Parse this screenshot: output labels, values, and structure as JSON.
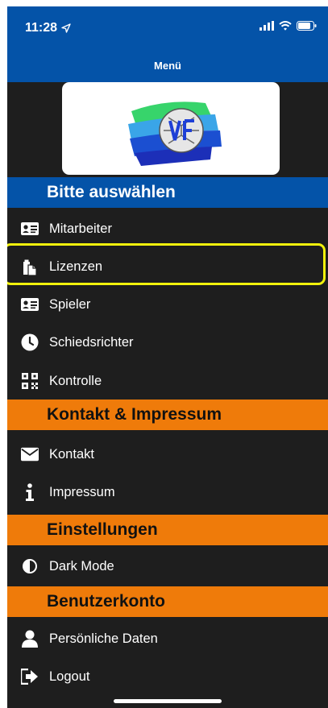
{
  "status_bar": {
    "time": "11:28"
  },
  "header": {
    "title": "Menü"
  },
  "sections": {
    "main": "Bitte auswählen",
    "contact": "Kontakt & Impressum",
    "settings": "Einstellungen",
    "account": "Benutzerkonto"
  },
  "menu": {
    "mitarbeiter": "Mitarbeiter",
    "lizenzen": "Lizenzen",
    "spieler": "Spieler",
    "schiedsrichter": "Schiedsrichter",
    "kontrolle": "Kontrolle",
    "kontakt": "Kontakt",
    "impressum": "Impressum",
    "dark_mode": "Dark Mode",
    "persoenliche_daten": "Persönliche Daten",
    "logout": "Logout"
  },
  "colors": {
    "header_blue": "#0453a8",
    "section_orange": "#ef7b0a",
    "background": "#1e1e1e",
    "highlight": "#f2f20c"
  },
  "icons": {
    "mitarbeiter": "id-card-icon",
    "lizenzen": "clipboard-copy-icon",
    "spieler": "id-card-icon",
    "schiedsrichter": "clock-icon",
    "kontrolle": "qr-code-icon",
    "kontakt": "envelope-icon",
    "impressum": "info-icon",
    "dark_mode": "contrast-icon",
    "persoenliche_daten": "user-icon",
    "logout": "sign-out-icon"
  }
}
